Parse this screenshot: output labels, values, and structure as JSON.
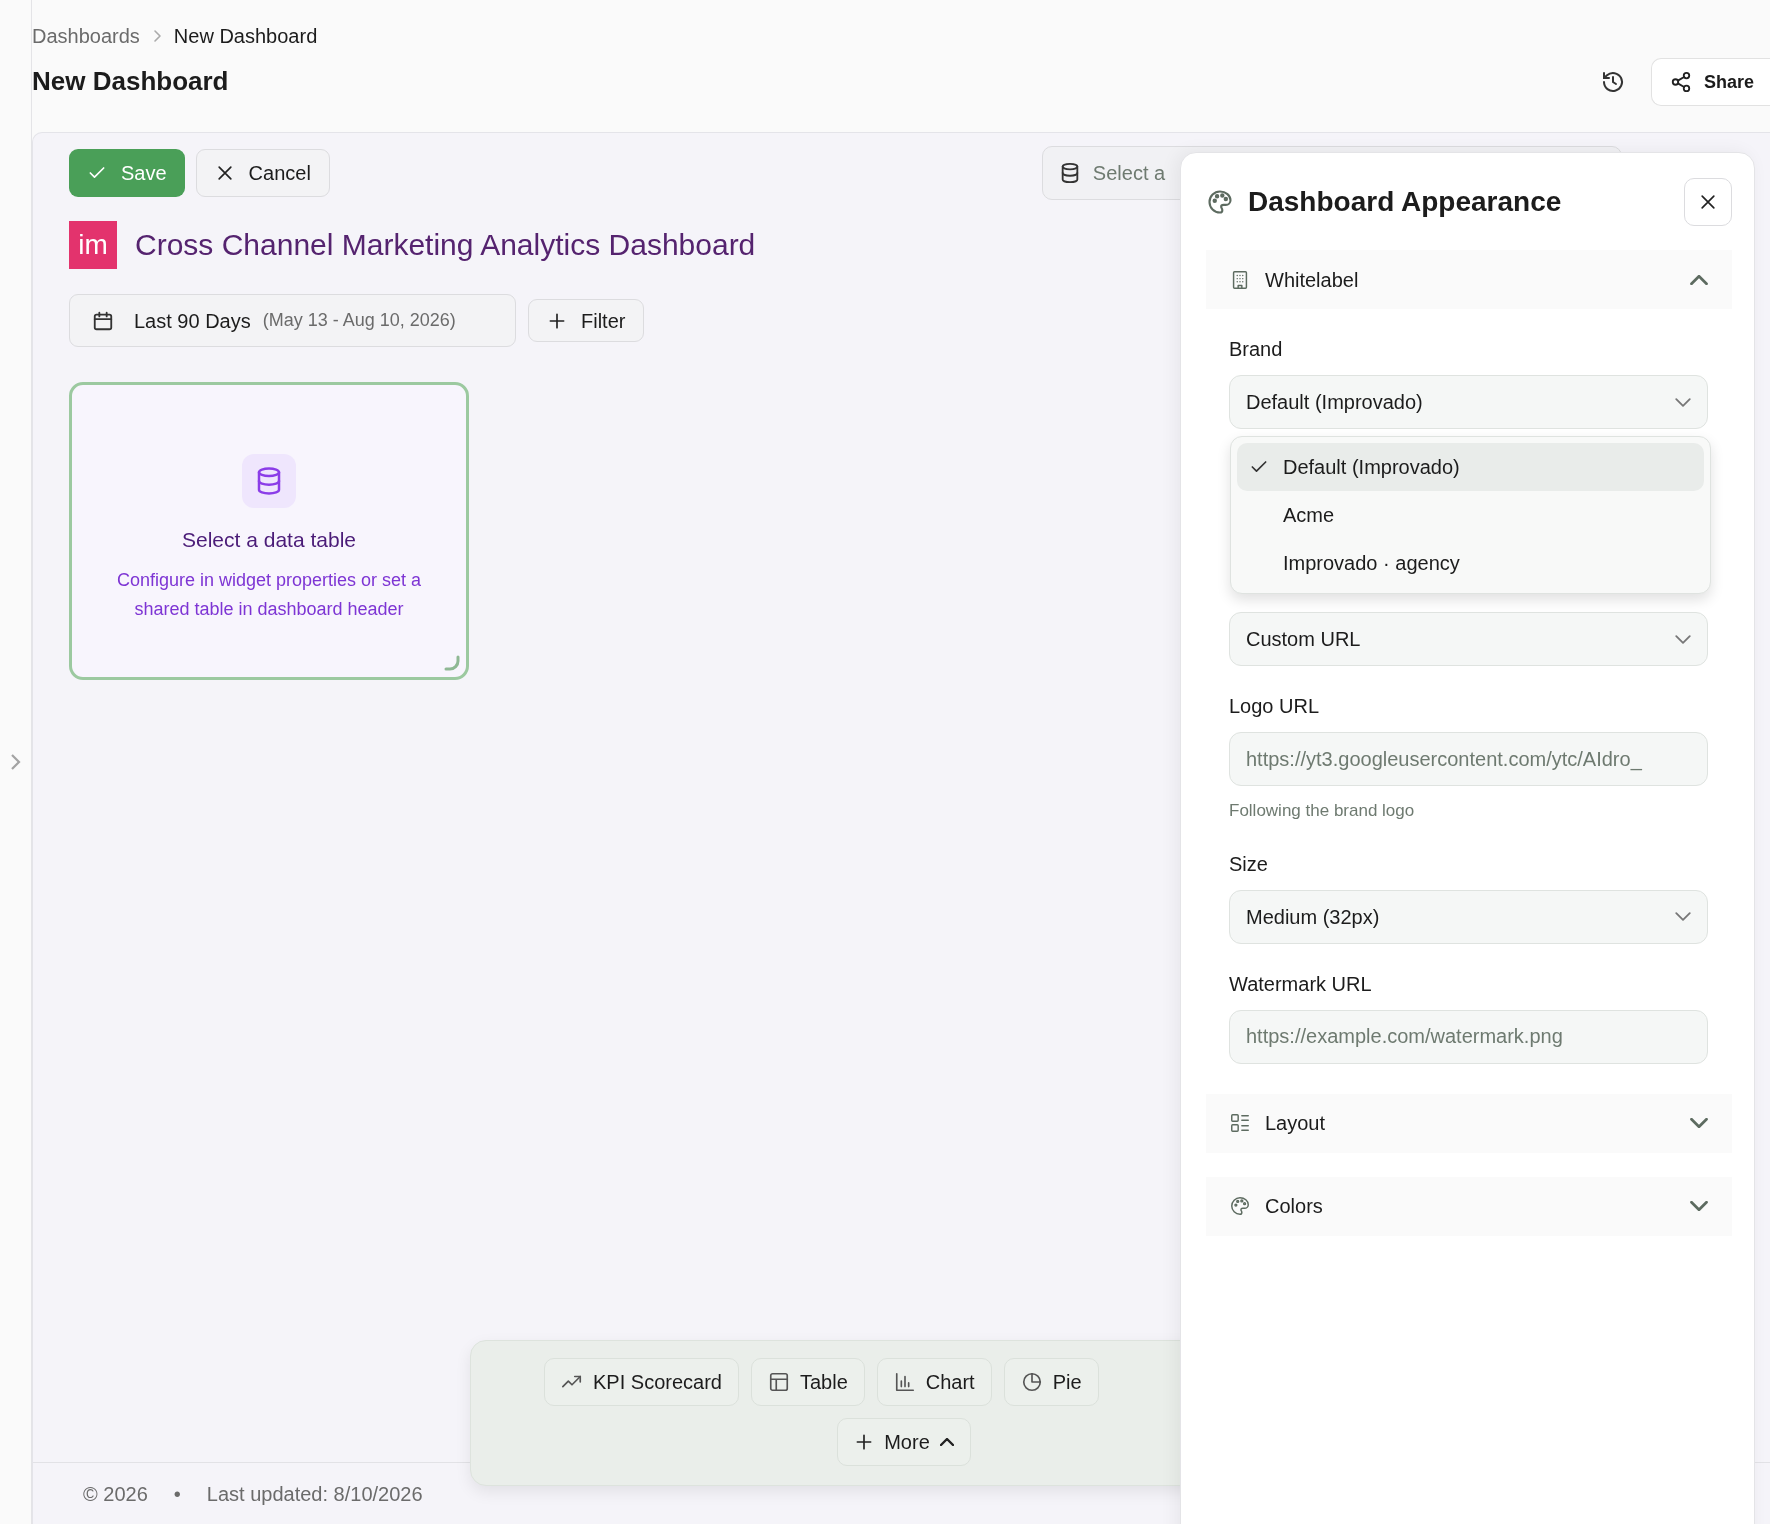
{
  "breadcrumb": [
    {
      "label": "Dashboards"
    },
    {
      "label": "New Dashboard"
    }
  ],
  "page_title": "New Dashboard",
  "header_actions": {
    "share": "Share"
  },
  "toolbar": {
    "save": "Save",
    "cancel": "Cancel",
    "table_select": {
      "placeholder": "Select a"
    }
  },
  "dashboard": {
    "logo": "im",
    "title": "Cross Channel Marketing Analytics Dashboard",
    "date_range": {
      "label": "Last 90 Days",
      "range": "(May 13 - Aug 10, 2026)"
    },
    "filter": "Filter"
  },
  "widget": {
    "title": "Select a data table",
    "description": "Configure in widget properties or set a shared table in dashboard header",
    "selected": true
  },
  "widget_bar": {
    "buttons": [
      {
        "label": "KPI Scorecard"
      },
      {
        "label": "Table"
      },
      {
        "label": "Chart"
      },
      {
        "label": "Pie"
      }
    ],
    "more": "More"
  },
  "footer": {
    "copyright": "© 2026",
    "separator": "•",
    "updated": "Last updated: 8/10/2026"
  },
  "panel": {
    "title": "Dashboard Appearance",
    "sections": [
      {
        "label": "Whitelabel",
        "expanded": true,
        "fields": [
          {
            "kind": "select",
            "label": "Brand",
            "value": "Default (Improvado)",
            "open": true,
            "options": [
              {
                "label": "Default (Improvado)",
                "selected": true
              },
              {
                "label": "Acme",
                "selected": false
              },
              {
                "label": "Improvado · agency",
                "selected": false
              }
            ]
          },
          {
            "kind": "select",
            "value": "Custom URL"
          },
          {
            "kind": "input",
            "label": "Logo URL",
            "placeholder": "https://yt3.googleusercontent.com/ytc/AIdro_",
            "help": "Following the brand logo"
          },
          {
            "kind": "select",
            "label": "Size",
            "value": "Medium (32px)"
          },
          {
            "kind": "input",
            "label": "Watermark URL",
            "placeholder": "https://example.com/watermark.png"
          }
        ]
      },
      {
        "label": "Layout",
        "expanded": false
      },
      {
        "label": "Colors",
        "expanded": false
      }
    ]
  }
}
